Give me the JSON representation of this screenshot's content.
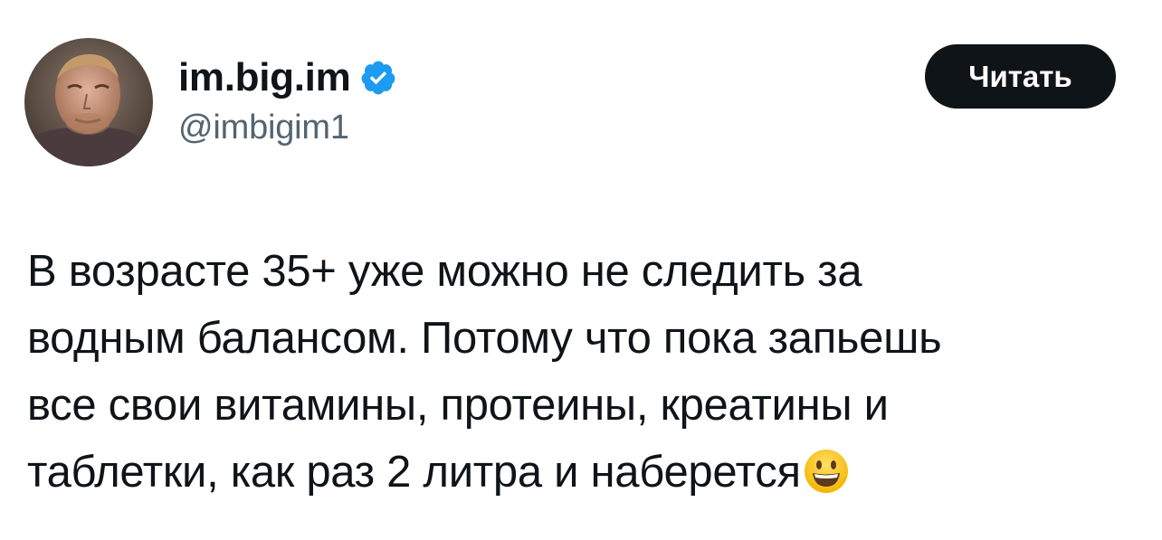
{
  "author": {
    "display_name": "im.big.im",
    "handle": "@imbigim1",
    "verified": true,
    "avatar_icon": "user-avatar-photo"
  },
  "actions": {
    "follow_label": "Читать"
  },
  "tweet": {
    "lines": [
      "В возрасте 35+ уже можно не следить за",
      "водным балансом. Потому что пока запьешь",
      "все свои витамины, протеины, креатины и",
      "таблетки, как раз 2 литра и наберется"
    ],
    "trailing_emoji": "grinning-face-emoji"
  },
  "colors": {
    "text_primary": "#0f1419",
    "text_secondary": "#536471",
    "verified_blue": "#1d9bf0",
    "button_bg": "#0f1419",
    "button_text": "#ffffff"
  }
}
